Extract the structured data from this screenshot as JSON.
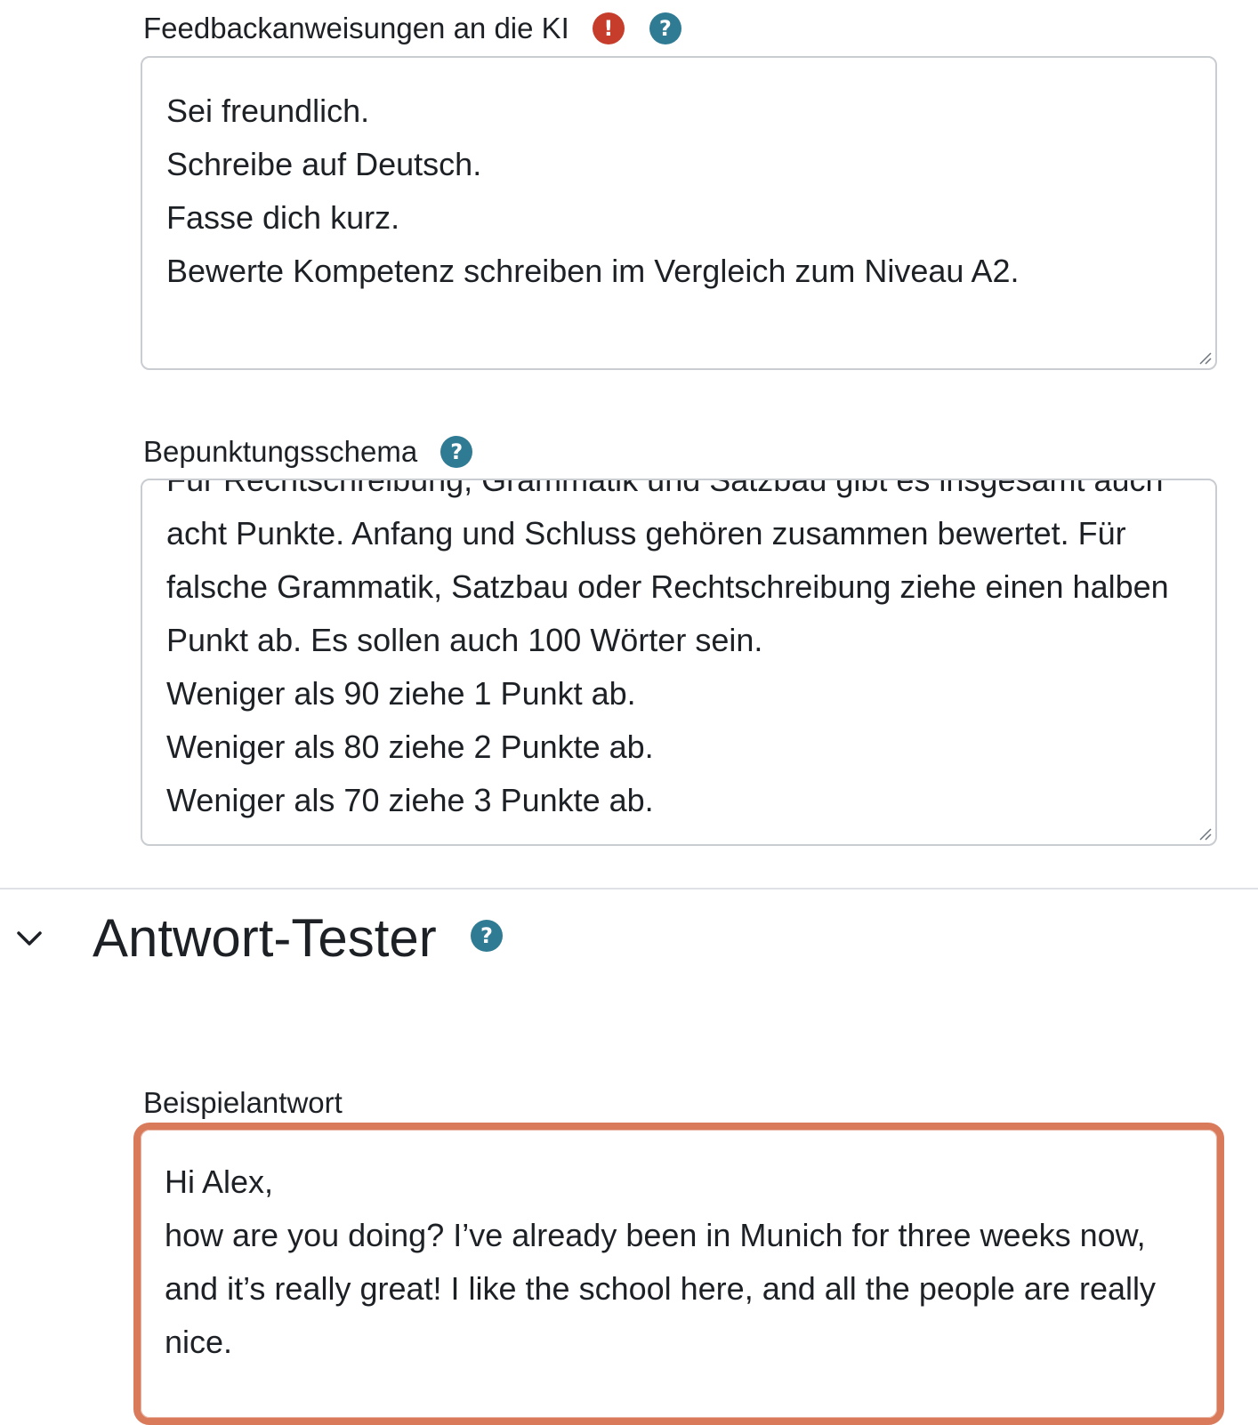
{
  "feedback": {
    "label": "Feedbackanweisungen an die KI",
    "required_icon": "!",
    "help_icon": "?",
    "text": "Sei freundlich.\nSchreibe auf Deutsch.\nFasse dich kurz.\nBewerte Kompetenz schreiben im Vergleich zum Niveau A2."
  },
  "grading": {
    "label": "Bepunktungsschema",
    "help_icon": "?",
    "text": "Für Rechtschreibung, Grammatik und Satzbau gibt es insgesamt auch acht Punkte. Anfang und Schluss gehören zusammen bewertet. Für falsche Grammatik, Satzbau oder Rechtschreibung ziehe einen halben Punkt ab. Es sollen auch 100 Wörter sein.\nWeniger als 90 ziehe 1 Punkt ab.\nWeniger als 80 ziehe 2 Punkte ab.\nWeniger als 70 ziehe 3 Punkte ab."
  },
  "section": {
    "title": "Antwort-Tester",
    "help_icon": "?"
  },
  "sample": {
    "label": "Beispielantwort",
    "text": "Hi Alex,\nhow are you doing? I’ve already been in Munich for three weeks now, and it’s really great! I like the school here, and all the people are really nice."
  },
  "colors": {
    "required": "#c63d2c",
    "help": "#2f7b94",
    "focus_border": "#d97a5b"
  }
}
